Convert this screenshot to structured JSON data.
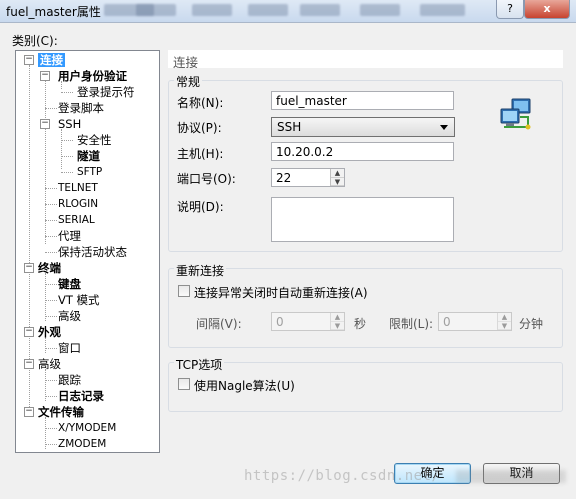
{
  "window": {
    "title": "fuel_master属性",
    "controls": {
      "minimize": "",
      "help": "?",
      "close": "x"
    }
  },
  "category_label": "类别(C):",
  "tree": {
    "connection": "连接",
    "user_auth": "用户身份验证",
    "login_prompt": "登录提示符",
    "login_script": "登录脚本",
    "ssh": "SSH",
    "security": "安全性",
    "tunnel": "隧道",
    "sftp": "SFTP",
    "telnet": "TELNET",
    "rlogin": "RLOGIN",
    "serial": "SERIAL",
    "proxy": "代理",
    "keepalive": "保持活动状态",
    "terminal": "终端",
    "keyboard": "键盘",
    "vt_mode": "VT 模式",
    "advanced_term": "高级",
    "appearance": "外观",
    "window": "窗口",
    "advanced": "高级",
    "trace": "跟踪",
    "logging": "日志记录",
    "file_transfer": "文件传输",
    "xymodem": "X/YMODEM",
    "zmodem": "ZMODEM",
    "collapse_symbol": "−",
    "expand_symbol": "+"
  },
  "panel": {
    "heading": "连接",
    "general": {
      "label": "常规",
      "name_label": "名称(N):",
      "name_value": "fuel_master",
      "protocol_label": "协议(P):",
      "protocol_value": "SSH",
      "host_label": "主机(H):",
      "host_value": "10.20.0.2",
      "port_label": "端口号(O):",
      "port_value": "22",
      "desc_label": "说明(D):",
      "desc_value": ""
    },
    "reconnect": {
      "label": "重新连接",
      "auto_reconnect": "连接异常关闭时自动重新连接(A)",
      "interval_label": "间隔(V):",
      "interval_value": "0",
      "seconds": "秒",
      "limit_label": "限制(L):",
      "limit_value": "0",
      "minutes": "分钟"
    },
    "tcp": {
      "label": "TCP选项",
      "nagle": "使用Nagle算法(U)"
    }
  },
  "buttons": {
    "ok": "确定",
    "cancel": "取消"
  },
  "watermark": "https://blog.csdn.net/"
}
